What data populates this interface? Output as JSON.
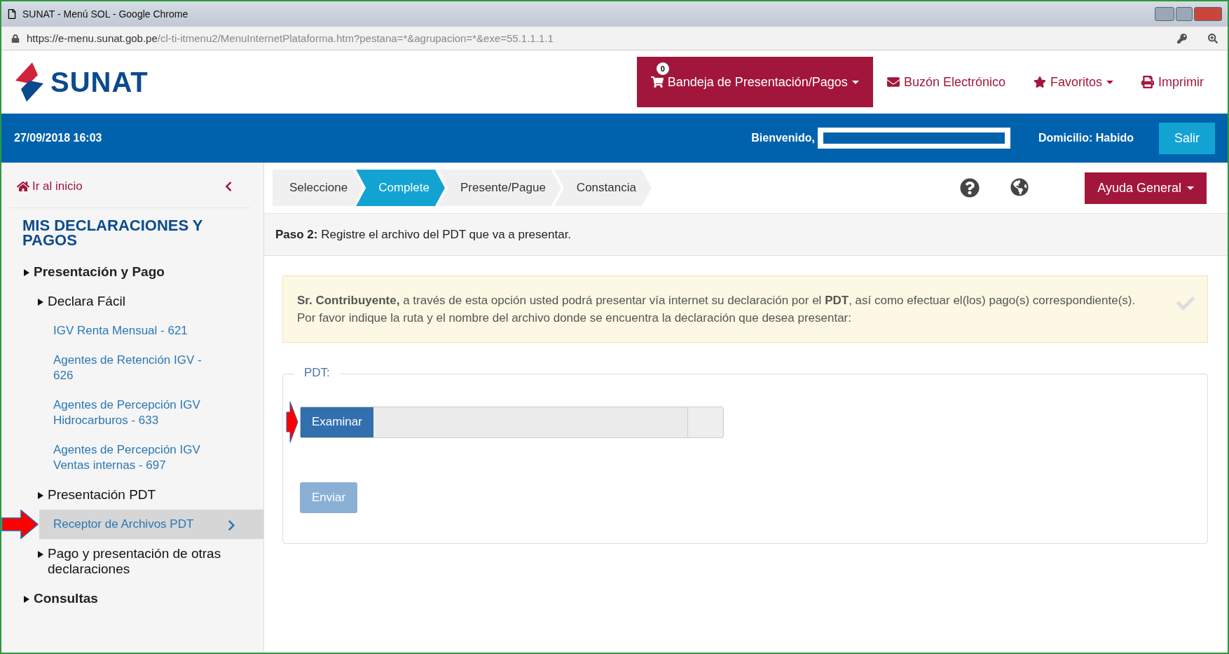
{
  "window": {
    "title": "SUNAT - Menú SOL - Google Chrome"
  },
  "address_bar": {
    "host": "https://e-menu.sunat.gob.pe",
    "path": "/cl-ti-itmenu2/MenuInternetPlataforma.htm?pestana=*&agrupacion=*&exe=55.1.1.1.1"
  },
  "header": {
    "logo": "SUNAT",
    "cart_count": "0",
    "nav": [
      {
        "kind": "primary",
        "label": "Bandeja de Presentación/Pagos",
        "dropdown": true
      },
      {
        "kind": "link",
        "label": "Buzón Electrónico",
        "dropdown": false
      },
      {
        "kind": "link",
        "label": "Favoritos",
        "dropdown": true
      },
      {
        "kind": "link",
        "label": "Imprimir",
        "dropdown": false
      }
    ]
  },
  "user_bar": {
    "datetime": "27/09/2018 16:03",
    "welcome": "Bienvenido,",
    "domicilio": "Domicilio: Habido",
    "logout": "Salir"
  },
  "sidebar": {
    "home": "Ir al inicio",
    "heading": "MIS DECLARACIONES Y PAGOS",
    "items": [
      {
        "label": "Presentación y Pago",
        "kind": "group",
        "children": [
          {
            "label": "Declara Fácil",
            "kind": "subgroup",
            "children": [
              {
                "label": "IGV Renta Mensual - 621",
                "kind": "link",
                "selected": false
              },
              {
                "label": "Agentes de Retención IGV - 626",
                "kind": "link",
                "selected": false
              },
              {
                "label": "Agentes de Percepción IGV Hidrocarburos - 633",
                "kind": "link",
                "selected": false
              },
              {
                "label": "Agentes de Percepción IGV Ventas internas - 697",
                "kind": "link",
                "selected": false
              }
            ]
          },
          {
            "label": "Presentación PDT",
            "kind": "subgroup",
            "children": [
              {
                "label": "Receptor de Archivos PDT",
                "kind": "link",
                "selected": true
              }
            ]
          },
          {
            "label": "Pago y presentación de otras declaraciones",
            "kind": "subgroup"
          }
        ]
      },
      {
        "label": "Consultas",
        "kind": "group"
      }
    ]
  },
  "steps": [
    {
      "label": "Seleccione",
      "selected": false
    },
    {
      "label": "Complete",
      "selected": true
    },
    {
      "label": "Presente/Pague",
      "selected": false
    },
    {
      "label": "Constancia",
      "selected": false
    }
  ],
  "help_button": "Ayuda General",
  "step_caption": {
    "label": "Paso 2:",
    "text": "Registre el archivo del PDT que va a presentar."
  },
  "notice": "**Sr. Contribuyente,** a través de esta opción usted podrá presentar vía internet su declaración por el **PDT**, así como efectuar el(los) pago(s) correspondiente(s). Por favor indique la ruta y el nombre del archivo donde se encuentra la declaración que desea presentar:",
  "form": {
    "legend": "PDT:",
    "browse": "Examinar",
    "submit": "Enviar",
    "submit_disabled": true
  }
}
